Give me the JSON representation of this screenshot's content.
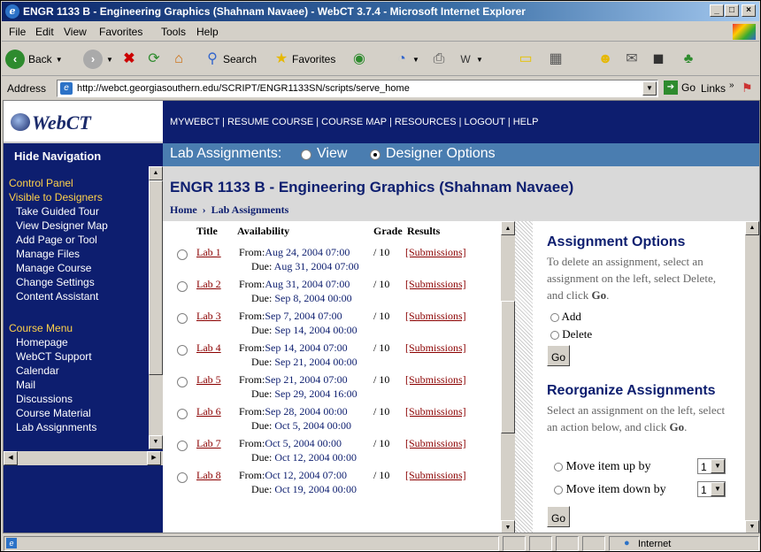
{
  "window": {
    "title": "ENGR 1133 B - Engineering Graphics (Shahnam Navaee) - WebCT 3.7.4 - Microsoft Internet Explorer",
    "min": "_",
    "max": "□",
    "close": "×"
  },
  "menu": [
    "File",
    "Edit",
    "View",
    "Favorites",
    "Tools",
    "Help"
  ],
  "toolbar": {
    "back": "Back",
    "search": "Search",
    "favorites": "Favorites"
  },
  "address": {
    "label": "Address",
    "url": "http://webct.georgiasouthern.edu/SCRIPT/ENGR1133SN/scripts/serve_home",
    "go": "Go",
    "links": "Links"
  },
  "webct": {
    "logo": "WebCT",
    "topnav": "MYWEBCT  |  RESUME COURSE  |  COURSE MAP  |  RESOURCES  |  LOGOUT  |  HELP",
    "hide_nav": "Hide Navigation",
    "assign_bar": {
      "label": "Lab Assignments:",
      "view": "View",
      "designer": "Designer Options"
    },
    "course_title": "ENGR 1133 B - Engineering Graphics (Shahnam Navaee)",
    "breadcrumb": {
      "home": "Home",
      "sep": "›",
      "current": "Lab Assignments"
    }
  },
  "sidebar": {
    "control_panel": "Control Panel",
    "visible": "Visible to Designers",
    "designer_items": [
      "Take Guided Tour",
      "View Designer Map",
      "Add Page or Tool",
      "Manage Files",
      "Manage Course",
      "Change Settings",
      "Content Assistant"
    ],
    "course_menu": "Course Menu",
    "course_items": [
      "Homepage",
      "WebCT Support",
      "Calendar",
      "Mail",
      "Discussions",
      "Course Material",
      "Lab Assignments"
    ]
  },
  "table": {
    "headers": {
      "title": "Title",
      "availability": "Availability",
      "grade": "Grade",
      "results": "Results"
    },
    "from_label": "From:",
    "due_label": "Due:",
    "rows": [
      {
        "lab": "Lab 1",
        "from": "Aug 24, 2004 07:00",
        "due": "Aug 31, 2004 07:00",
        "grade": "/ 10",
        "results": "[Submissions]"
      },
      {
        "lab": "Lab 2",
        "from": "Aug 31, 2004 07:00",
        "due": "Sep 8, 2004 00:00",
        "grade": "/ 10",
        "results": "[Submissions]"
      },
      {
        "lab": "Lab 3",
        "from": "Sep 7, 2004 07:00",
        "due": "Sep 14, 2004 00:00",
        "grade": "/ 10",
        "results": "[Submissions]"
      },
      {
        "lab": "Lab 4",
        "from": "Sep 14, 2004 07:00",
        "due": "Sep 21, 2004 00:00",
        "grade": "/ 10",
        "results": "[Submissions]"
      },
      {
        "lab": "Lab 5",
        "from": "Sep 21, 2004 07:00",
        "due": "Sep 29, 2004 16:00",
        "grade": "/ 10",
        "results": "[Submissions]"
      },
      {
        "lab": "Lab 6",
        "from": "Sep 28, 2004 00:00",
        "due": "Oct 5, 2004 00:00",
        "grade": "/ 10",
        "results": "[Submissions]"
      },
      {
        "lab": "Lab 7",
        "from": "Oct 5, 2004 00:00",
        "due": "Oct 12, 2004 00:00",
        "grade": "/ 10",
        "results": "[Submissions]"
      },
      {
        "lab": "Lab 8",
        "from": "Oct 12, 2004 07:00",
        "due": "Oct 19, 2004 00:00",
        "grade": "/ 10",
        "results": "[Submissions]"
      }
    ]
  },
  "options": {
    "assign_title": "Assignment Options",
    "assign_desc_1": "To delete an assignment, select an assignment on the left, select Delete, and click ",
    "go_word": "Go",
    "period": ".",
    "add": "Add",
    "delete": "Delete",
    "go": "Go",
    "reorg_title": "Reorganize Assignments",
    "reorg_desc": "Select an assignment on the left, select an action below, and click ",
    "move_up": "Move item up by",
    "move_down": "Move item down by",
    "move_value": "1"
  },
  "status": {
    "zone": "Internet"
  }
}
